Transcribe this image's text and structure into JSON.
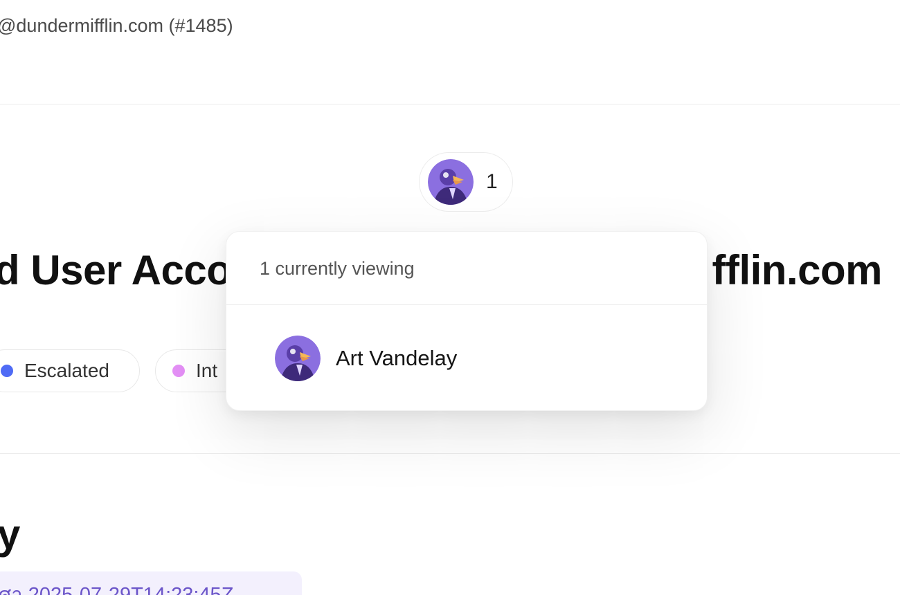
{
  "header": {
    "requester_email_fragment": "@dundermifflin.com (#1485)"
  },
  "ticket": {
    "title_visible_start": "d User Acco",
    "title_visible_end": "fflin.com",
    "tags": [
      {
        "label": "Escalated",
        "dot_color": "#4f6bf5"
      },
      {
        "label": "Int",
        "dot_color": "#e38ff5"
      }
    ]
  },
  "presence": {
    "viewer_count": "1",
    "popover_heading": "1 currently viewing",
    "viewers": [
      {
        "name": "Art Vandelay",
        "avatar_icon": "user-avatar-icon"
      }
    ]
  },
  "activity": {
    "section_title_fragment": "y",
    "timestamp_fragment": "ศา 2025-07-29T14:23:45Z"
  },
  "colors": {
    "avatar_bg": "#8b6fe0",
    "accent": "#6b55c9"
  }
}
